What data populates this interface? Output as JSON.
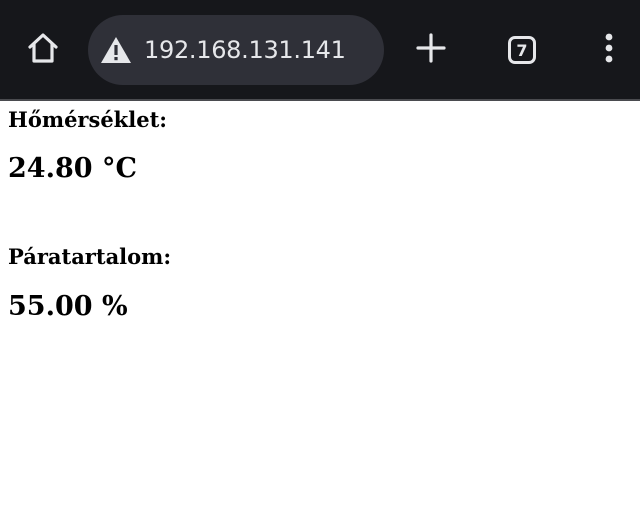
{
  "browser": {
    "url": "192.168.131.141",
    "tab_count": "7",
    "icons": {
      "home": "home-icon",
      "security_warning": "warning-triangle-icon",
      "new_tab": "plus-icon",
      "tabs": "tab-switcher-icon",
      "menu": "more-vert-icon"
    },
    "colors": {
      "toolbar_bg": "#16171b",
      "urlbar_bg": "#2f3038",
      "icon": "#e6e7ea"
    }
  },
  "page": {
    "temperature_label": "Hőmérséklet:",
    "temperature_value": "24.80 °C",
    "humidity_label": "Páratartalom:",
    "humidity_value": "55.00 %"
  }
}
